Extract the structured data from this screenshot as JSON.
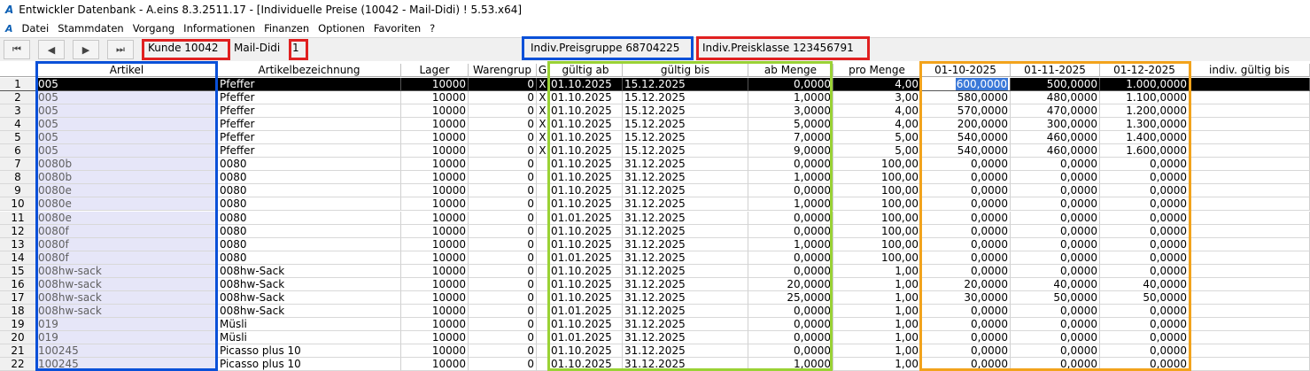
{
  "window": {
    "logo": "A",
    "title": "Entwickler Datenbank - A.eins 8.3.2511.17 - [Individuelle Preise (10042 - Mail-Didi) ! 5.53.x64]"
  },
  "menu": {
    "logo": "A",
    "items": [
      "Datei",
      "Stammdaten",
      "Vorgang",
      "Informationen",
      "Finanzen",
      "Optionen",
      "Favoriten",
      "?"
    ]
  },
  "nav": {
    "first": "⏮",
    "prev": "◀",
    "next": "▶",
    "last": "⏭"
  },
  "toolbar": {
    "kunde": "Kunde 10042",
    "name": "Mail-Didi",
    "number": "1",
    "preisgruppe": "Indiv.Preisgruppe 68704225",
    "preisklasse": "Indiv.Preisklasse 123456791"
  },
  "columns": [
    "Artikel",
    "Artikelbezeichnung",
    "Lager",
    "Warengrup",
    "G",
    "gültig ab",
    "gültig bis",
    "ab Menge",
    "pro Menge",
    "01-10-2025",
    "01-11-2025",
    "01-12-2025",
    "indiv. gültig bis"
  ],
  "rows": [
    [
      "1",
      "005",
      "Pfeffer",
      "10000",
      "0",
      "X",
      "01.10.2025",
      "15.12.2025",
      "0,0000",
      "4,00",
      "600,0000",
      "500,0000",
      "1.000,0000",
      ""
    ],
    [
      "2",
      "005",
      "Pfeffer",
      "10000",
      "0",
      "X",
      "01.10.2025",
      "15.12.2025",
      "1,0000",
      "3,00",
      "580,0000",
      "480,0000",
      "1.100,0000",
      ""
    ],
    [
      "3",
      "005",
      "Pfeffer",
      "10000",
      "0",
      "X",
      "01.10.2025",
      "15.12.2025",
      "3,0000",
      "4,00",
      "570,0000",
      "470,0000",
      "1.200,0000",
      ""
    ],
    [
      "4",
      "005",
      "Pfeffer",
      "10000",
      "0",
      "X",
      "01.10.2025",
      "15.12.2025",
      "5,0000",
      "4,00",
      "200,0000",
      "300,0000",
      "1.300,0000",
      ""
    ],
    [
      "5",
      "005",
      "Pfeffer",
      "10000",
      "0",
      "X",
      "01.10.2025",
      "15.12.2025",
      "7,0000",
      "5,00",
      "540,0000",
      "460,0000",
      "1.400,0000",
      ""
    ],
    [
      "6",
      "005",
      "Pfeffer",
      "10000",
      "0",
      "X",
      "01.10.2025",
      "15.12.2025",
      "9,0000",
      "5,00",
      "540,0000",
      "460,0000",
      "1.600,0000",
      ""
    ],
    [
      "7",
      "0080b",
      "0080",
      "10000",
      "0",
      "",
      "01.10.2025",
      "31.12.2025",
      "0,0000",
      "100,00",
      "0,0000",
      "0,0000",
      "0,0000",
      ""
    ],
    [
      "8",
      "0080b",
      "0080",
      "10000",
      "0",
      "",
      "01.10.2025",
      "31.12.2025",
      "1,0000",
      "100,00",
      "0,0000",
      "0,0000",
      "0,0000",
      ""
    ],
    [
      "9",
      "0080e",
      "0080",
      "10000",
      "0",
      "",
      "01.10.2025",
      "31.12.2025",
      "0,0000",
      "100,00",
      "0,0000",
      "0,0000",
      "0,0000",
      ""
    ],
    [
      "10",
      "0080e",
      "0080",
      "10000",
      "0",
      "",
      "01.10.2025",
      "31.12.2025",
      "1,0000",
      "100,00",
      "0,0000",
      "0,0000",
      "0,0000",
      ""
    ],
    [
      "11",
      "0080e",
      "0080",
      "10000",
      "0",
      "",
      "01.01.2025",
      "31.12.2025",
      "0,0000",
      "100,00",
      "0,0000",
      "0,0000",
      "0,0000",
      ""
    ],
    [
      "12",
      "0080f",
      "0080",
      "10000",
      "0",
      "",
      "01.10.2025",
      "31.12.2025",
      "0,0000",
      "100,00",
      "0,0000",
      "0,0000",
      "0,0000",
      ""
    ],
    [
      "13",
      "0080f",
      "0080",
      "10000",
      "0",
      "",
      "01.10.2025",
      "31.12.2025",
      "1,0000",
      "100,00",
      "0,0000",
      "0,0000",
      "0,0000",
      ""
    ],
    [
      "14",
      "0080f",
      "0080",
      "10000",
      "0",
      "",
      "01.01.2025",
      "31.12.2025",
      "0,0000",
      "100,00",
      "0,0000",
      "0,0000",
      "0,0000",
      ""
    ],
    [
      "15",
      "008hw-sack",
      "008hw-Sack",
      "10000",
      "0",
      "",
      "01.10.2025",
      "31.12.2025",
      "0,0000",
      "1,00",
      "0,0000",
      "0,0000",
      "0,0000",
      ""
    ],
    [
      "16",
      "008hw-sack",
      "008hw-Sack",
      "10000",
      "0",
      "",
      "01.10.2025",
      "31.12.2025",
      "20,0000",
      "1,00",
      "20,0000",
      "40,0000",
      "40,0000",
      ""
    ],
    [
      "17",
      "008hw-sack",
      "008hw-Sack",
      "10000",
      "0",
      "",
      "01.10.2025",
      "31.12.2025",
      "25,0000",
      "1,00",
      "30,0000",
      "50,0000",
      "50,0000",
      ""
    ],
    [
      "18",
      "008hw-sack",
      "008hw-Sack",
      "10000",
      "0",
      "",
      "01.01.2025",
      "31.12.2025",
      "0,0000",
      "1,00",
      "0,0000",
      "0,0000",
      "0,0000",
      ""
    ],
    [
      "19",
      "019",
      "Müsli",
      "10000",
      "0",
      "",
      "01.10.2025",
      "31.12.2025",
      "0,0000",
      "1,00",
      "0,0000",
      "0,0000",
      "0,0000",
      ""
    ],
    [
      "20",
      "019",
      "Müsli",
      "10000",
      "0",
      "",
      "01.01.2025",
      "31.12.2025",
      "0,0000",
      "1,00",
      "0,0000",
      "0,0000",
      "0,0000",
      ""
    ],
    [
      "21",
      "100245",
      "Picasso plus 10",
      "10000",
      "0",
      "",
      "01.10.2025",
      "31.12.2025",
      "0,0000",
      "1,00",
      "0,0000",
      "0,0000",
      "0,0000",
      ""
    ],
    [
      "22",
      "100245",
      "Picasso plus 10",
      "10000",
      "0",
      "",
      "01.10.2025",
      "31.12.2025",
      "1,0000",
      "1,00",
      "0,0000",
      "0,0000",
      "0,0000",
      ""
    ]
  ],
  "colors": {
    "highlight_red": "#e02020",
    "highlight_blue": "#0a50d8",
    "highlight_green": "#9ad235",
    "highlight_orange": "#f2a31c",
    "selected_row": "#000000",
    "artikel_bg": "#e6e6f8"
  }
}
